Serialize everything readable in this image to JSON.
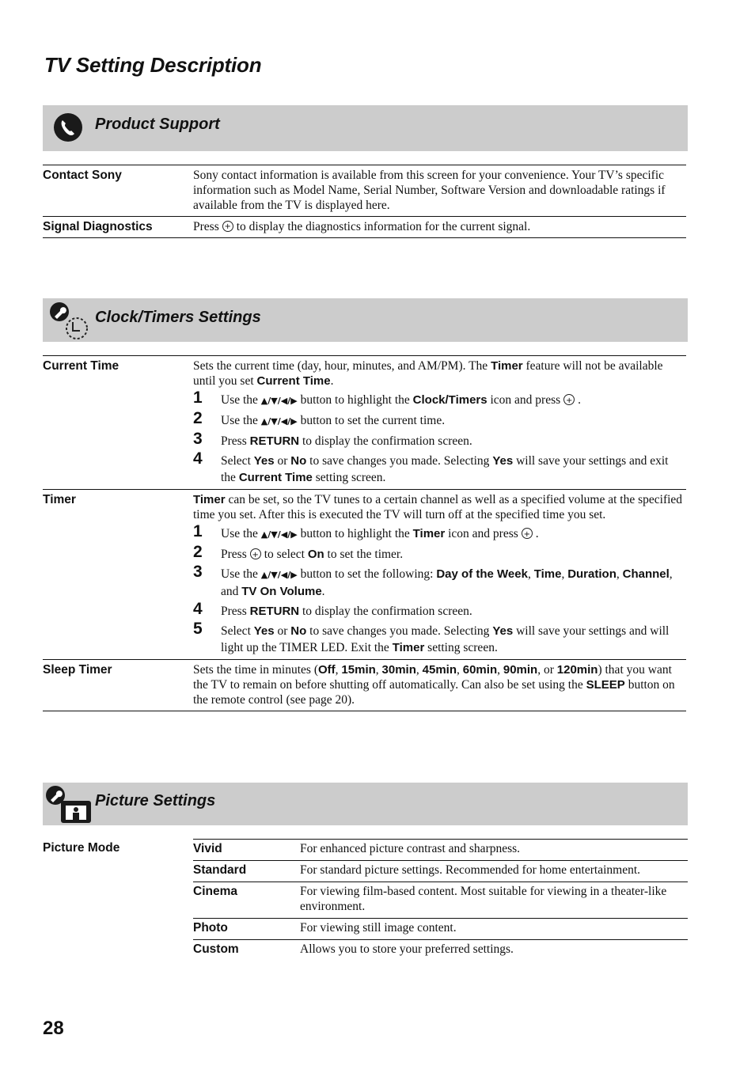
{
  "page": {
    "title": "TV Setting Description",
    "page_number": "28"
  },
  "sections": {
    "product_support": {
      "title": "Product Support",
      "icon": "phone-icon",
      "rows": {
        "contact": {
          "term": "Contact Sony",
          "desc": "Sony contact information is available from this screen for your convenience. Your TV’s specific information such as Model Name, Serial Number, Software Version and downloadable ratings if available from the TV is displayed here."
        },
        "signal": {
          "term": "Signal Diagnostics",
          "desc_pre": "Press",
          "desc_post": "to display the diagnostics information for the current signal."
        }
      }
    },
    "clock": {
      "title": "Clock/Timers Settings",
      "icon": "clock-wrench-icon",
      "current_time": {
        "term": "Current Time",
        "intro_1": "Sets the current time (day, hour, minutes, and AM/PM). The",
        "intro_b1": "Timer",
        "intro_2": "feature will not be available until you set",
        "intro_b2": "Current Time",
        "intro_3": ".",
        "steps": [
          {
            "n": "1",
            "a": "Use the",
            "arrows": "▲/▼/◀/▶",
            "b": "button to highlight the",
            "bold": "Clock/Timers",
            "c": "icon and press",
            "d": "."
          },
          {
            "n": "2",
            "a": "Use the",
            "arrows": "▲/▼/◀/▶",
            "b": "button to set the current time."
          },
          {
            "n": "3",
            "a": "Press",
            "bold": "RETURN",
            "b": "to display the confirmation screen."
          },
          {
            "n": "4",
            "a": "Select",
            "bold1": "Yes",
            "b": "or",
            "bold2": "No",
            "c": "to save changes you made. Selecting",
            "bold3": "Yes",
            "d": "will save your settings and exit the",
            "bold4": "Current Time",
            "e": "setting screen."
          }
        ]
      },
      "timer": {
        "term": "Timer",
        "intro_b": "Timer",
        "intro": "can be set, so the TV tunes to a certain channel as well as a specified volume at the specified time you set. After this is executed the TV will turn off at the specified time you set.",
        "steps": [
          {
            "n": "1",
            "a": "Use the",
            "arrows": "▲/▼/◀/▶",
            "b": "button to highlight the",
            "bold": "Timer",
            "c": "icon and press",
            "d": "."
          },
          {
            "n": "2",
            "a": "Press",
            "b": "to select",
            "bold": "On",
            "c": "to set the timer."
          },
          {
            "n": "3",
            "a": "Use the",
            "arrows": "▲/▼/◀/▶",
            "b": "button to set the following:",
            "bold1": "Day of the Week",
            "s1": ",",
            "bold2": "Time",
            "s2": ",",
            "bold3": "Duration",
            "s3": ",",
            "bold4": "Channel",
            "s4": ", and",
            "bold5": "TV On Volume",
            "s5": "."
          },
          {
            "n": "4",
            "a": "Press",
            "bold": "RETURN",
            "b": "to display the confirmation screen."
          },
          {
            "n": "5",
            "a": "Select",
            "bold1": "Yes",
            "b": "or",
            "bold2": "No",
            "c": "to save changes you made. Selecting",
            "bold3": "Yes",
            "d": "will save your settings and will light up the TIMER LED. Exit the",
            "bold4": "Timer",
            "e": "setting screen."
          }
        ]
      },
      "sleep": {
        "term": "Sleep Timer",
        "a": "Sets the time in minutes (",
        "options": [
          "Off",
          "15min",
          "30min",
          "45min",
          "60min",
          "90min",
          "120min"
        ],
        "sep": ", ",
        "or": ", or ",
        "b": ") that you want the TV to remain on before shutting off automatically. Can also be set using the",
        "bold": "SLEEP",
        "c": "button on the remote control (see page 20)."
      }
    },
    "picture": {
      "title": "Picture Settings",
      "icon": "picture-wrench-icon",
      "term": "Picture Mode",
      "modes": [
        {
          "name": "Vivid",
          "desc": "For enhanced picture contrast and sharpness."
        },
        {
          "name": "Standard",
          "desc": "For standard picture settings. Recommended for home entertainment."
        },
        {
          "name": "Cinema",
          "desc": "For viewing film-based content. Most suitable for viewing in a theater-like environment."
        },
        {
          "name": "Photo",
          "desc": "For viewing still image content."
        },
        {
          "name": "Custom",
          "desc": "Allows you to store your preferred settings."
        }
      ]
    }
  }
}
